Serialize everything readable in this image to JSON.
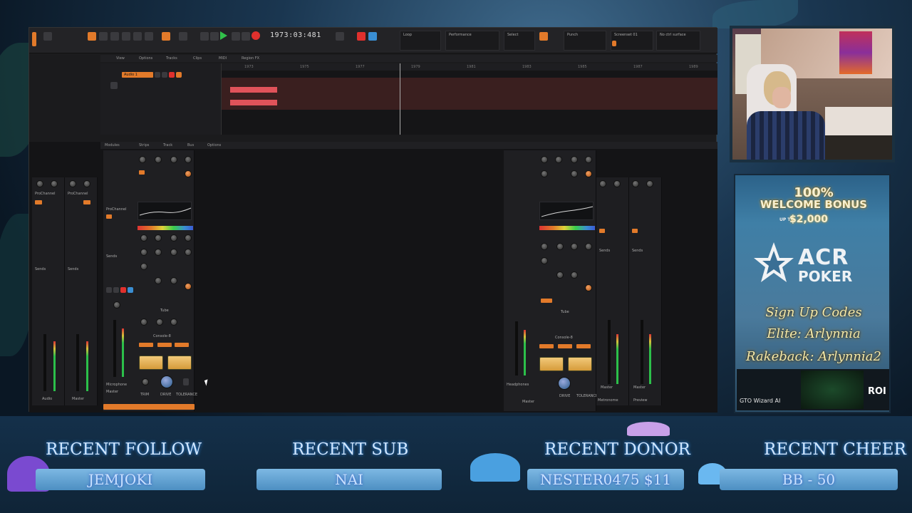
{
  "daw": {
    "timecode": "1973:03:481",
    "menu": [
      "View",
      "Options",
      "Tracks",
      "Clips",
      "MIDI",
      "Region FX"
    ],
    "console_menu": [
      "Modules",
      "Strips",
      "Track",
      "Bus",
      "Options"
    ],
    "ruler": [
      "1973",
      "1975",
      "1977",
      "1979",
      "1981",
      "1983",
      "1985",
      "1987",
      "1989"
    ],
    "track_name": "Audio 1",
    "panels": [
      "Loop",
      "Performance",
      "Select",
      "Punch",
      "Screenset 01",
      "No ctrl surface"
    ],
    "strip_labels": {
      "audio": "Audio",
      "master": "Master",
      "headphones": "Headphones",
      "metronome": "Metronome",
      "preview": "Preview",
      "microphone": "Microphone",
      "prochannel": "ProChannel",
      "sends": "Sends",
      "tube": "Tube",
      "console": "Console-8",
      "drive": "DRIVE",
      "trim": "TRIM",
      "tolerance": "TOLERANCE"
    }
  },
  "ad": {
    "bonus_line1": "100%",
    "bonus_line2": "WELCOME BONUS",
    "bonus_upto": "UP TO",
    "bonus_amount": "$2,000",
    "brand_acr": "ACR",
    "brand_poker": "POKER",
    "signup_title": "Sign Up Codes",
    "elite_code": "Elite: Arlynnia",
    "rakeback_code": "Rakeback: Arlynnia2",
    "gto_label": "GTO Wizard AI",
    "roi_label": "ROI"
  },
  "overlay": {
    "recent_follow_title": "RECENT FOLLOW",
    "recent_follow_name": "JEMJOKI",
    "recent_sub_title": "RECENT SUB",
    "recent_sub_name": "NAI",
    "recent_donor_title": "RECENT DONOR",
    "recent_donor_name": "NESTER0475 $11",
    "recent_cheer_title": "RECENT CHEER",
    "recent_cheer_name": "BB - 50"
  },
  "colors": {
    "accent_orange": "#e27a2a",
    "play_green": "#31c04a",
    "record_red": "#e0302d",
    "clip_red": "#e0535a"
  }
}
